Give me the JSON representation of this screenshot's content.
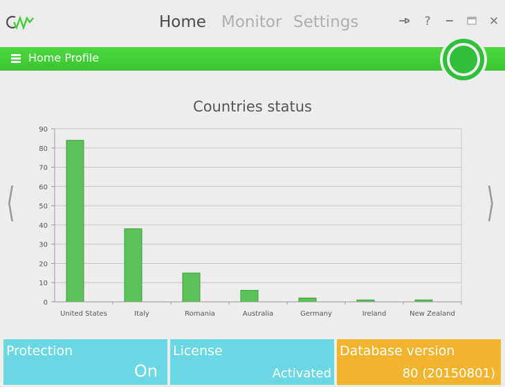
{
  "header": {
    "nav": [
      "Home",
      "Monitor",
      "Settings"
    ],
    "controls": [
      "pin-icon",
      "help-icon",
      "minimize-icon",
      "maximize-icon",
      "close-icon"
    ],
    "help_glyph": "?",
    "close_glyph": "✕"
  },
  "profile": {
    "name": "Home Profile",
    "status_color": "#2fbf3b"
  },
  "chart": {
    "title": "Countries status"
  },
  "chart_data": {
    "type": "bar",
    "title": "Countries status",
    "categories": [
      "United States",
      "Italy",
      "Romania",
      "Australia",
      "Germany",
      "Ireland",
      "New Zealand"
    ],
    "values": [
      84,
      38,
      15,
      6,
      2,
      1,
      1
    ],
    "ylim": [
      0,
      90
    ],
    "yticks": [
      0,
      10,
      20,
      30,
      40,
      50,
      60,
      70,
      80,
      90
    ],
    "grid": true,
    "bar_color": "#5bc257"
  },
  "nav_arrows": {
    "left": "⟨",
    "right": "⟩"
  },
  "tiles": {
    "protection": {
      "label": "Protection",
      "value": "On"
    },
    "license": {
      "label": "License",
      "value": "Activated"
    },
    "database": {
      "label": "Database version",
      "value": "80 (20150801)"
    }
  },
  "colors": {
    "green": "#3fcf36",
    "cyan": "#6bd7e3",
    "orange": "#f2b32e"
  }
}
